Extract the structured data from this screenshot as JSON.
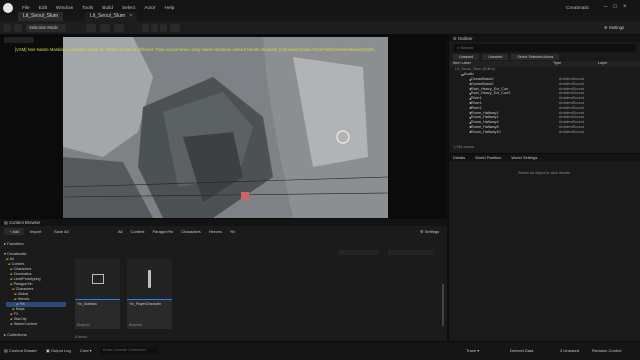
{
  "tabs": [
    {
      "label": "Lit_Seoul_Slum"
    },
    {
      "label": "Lit_Seoul_Slum"
    }
  ],
  "user": "Creatmatic",
  "menu": [
    "File",
    "Edit",
    "Window",
    "Tools",
    "Build",
    "Select",
    "Actor",
    "Help"
  ],
  "toolbar": {
    "mode": "Selection Mode",
    "settings": "Settings"
  },
  "viewport": {
    "warning": "[VSM] Non-Nanite Masking in Shadow Depth for Distance may be affected: Pass occurs when using Nanite shadows without Nanite Shadows (r.Shadow.Virtual.ForceFullNonNaniteMaskInDepth)"
  },
  "outliner": {
    "title": "Outliner",
    "search_placeholder": "Search",
    "filters": [
      "Unsaved",
      "Unsaved",
      "Select Selected Actors"
    ],
    "columns": [
      "Item Label",
      "Type",
      "Layer"
    ],
    "folder_row": "Lit_Seoul_Slum (Editor)",
    "folder": "Audio",
    "rows": [
      {
        "label": "OceanBasic0",
        "type": "AmbientSound"
      },
      {
        "label": "OceanBasic0",
        "type": "AmbientSound"
      },
      {
        "label": "Rain_Heavy_Ext_Cue",
        "type": "AmbientSound"
      },
      {
        "label": "Rain_Heavy_Ext_Cue2",
        "type": "AmbientSound"
      },
      {
        "label": "River1",
        "type": "AmbientSound"
      },
      {
        "label": "River1",
        "type": "AmbientSound"
      },
      {
        "label": "River1",
        "type": "AmbientSound"
      },
      {
        "label": "Room_Hallway1",
        "type": "AmbientSound"
      },
      {
        "label": "Room_Hallway1",
        "type": "AmbientSound"
      },
      {
        "label": "Room_Hallway4",
        "type": "AmbientSound"
      },
      {
        "label": "Room_Hallway8",
        "type": "AmbientSound"
      },
      {
        "label": "Room_Hallway10",
        "type": "AmbientSound"
      }
    ],
    "count": "1,784 actors"
  },
  "details": {
    "tabs": [
      "Details",
      "World Partition",
      "World Settings"
    ],
    "empty": "Select an object to view details."
  },
  "content_browser": {
    "title": "Content Browser",
    "add": "Add",
    "import": "Import",
    "save_all": "Save All",
    "all": "All",
    "breadcrumb": [
      "All",
      "Content",
      "ParagonYin",
      "Characters",
      "Heroes",
      "Yin"
    ],
    "settings": "Settings",
    "favorites": "Favorites",
    "root": "Creatmatic",
    "tree": [
      "All",
      "Content",
      "Characters",
      "Cinematics",
      "LevelPrototyping",
      "ParagonYin",
      "Characters",
      "Global",
      "Heroes",
      "Yin",
      "Maps",
      "FX",
      "StarCity",
      "StarterContent"
    ],
    "search_placeholder": "Search Yin",
    "assets": [
      {
        "name": "Yin_Sidekick",
        "type": "Blueprint"
      },
      {
        "name": "Yin_PlayerCharacter",
        "type": "Blueprint"
      }
    ],
    "item_count": "5 items",
    "collections": "Collections"
  },
  "statusbar": {
    "content_drawer": "Content Drawer",
    "output_log": "Output Log",
    "cmd": "Cmd",
    "console_placeholder": "Enter Console Command",
    "trace": "Trace",
    "derived_data": "Derived Data",
    "unsaved": "3 Unsaved",
    "revision": "Revision Control"
  },
  "colors": {
    "accent": "#2a7be4",
    "warning": "#d8d83a",
    "folder": "#c9a14a"
  }
}
